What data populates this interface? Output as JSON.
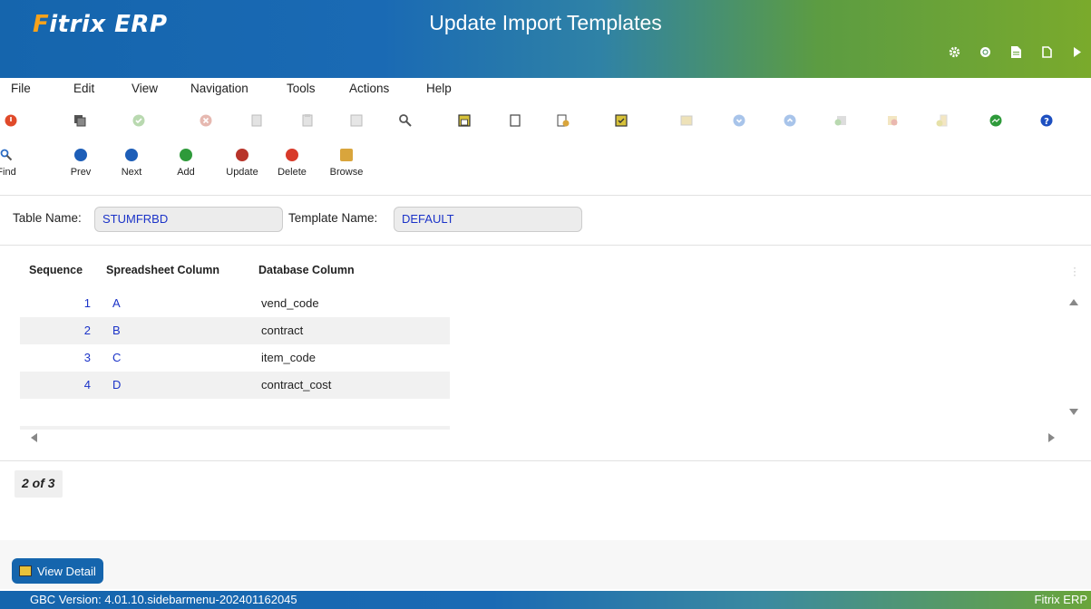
{
  "header": {
    "logo_text": "Fitrix ERP",
    "title": "Update Import Templates",
    "icons": [
      "gear-icon",
      "globe-icon",
      "document-icon",
      "new-page-icon",
      "play-icon"
    ]
  },
  "menu": [
    "File",
    "Edit",
    "View",
    "Navigation",
    "Tools",
    "Actions",
    "Help"
  ],
  "toolbar_icons": [
    "exit-icon",
    "copy-icon",
    "accept-icon",
    "cancel-icon",
    "copy-doc-icon",
    "paste-icon",
    "clipboard-icon",
    "zoom-icon",
    "save-icon",
    "attach-icon",
    "import-icon",
    "export-icon",
    "grid-icon",
    "down-icon",
    "up-icon",
    "insert-row-icon",
    "delete-row-icon",
    "append-icon",
    "chart-icon",
    "help-icon"
  ],
  "actions": [
    {
      "label": "Find",
      "icon": "find-icon",
      "color": "#2a6bc4"
    },
    {
      "label": "Prev",
      "icon": "prev-icon",
      "color": "#1d5eb8"
    },
    {
      "label": "Next",
      "icon": "next-icon",
      "color": "#1d5eb8"
    },
    {
      "label": "Add",
      "icon": "add-icon",
      "color": "#2e9a3a"
    },
    {
      "label": "Update",
      "icon": "update-icon",
      "color": "#c23a2a"
    },
    {
      "label": "Delete",
      "icon": "delete-icon",
      "color": "#d83a2a"
    },
    {
      "label": "Browse",
      "icon": "browse-icon",
      "color": "#d9a53c"
    }
  ],
  "form": {
    "table_name_label": "Table Name:",
    "table_name_value": "STUMFRBD",
    "template_name_label": "Template Name:",
    "template_name_value": "DEFAULT"
  },
  "grid": {
    "columns": [
      "Sequence",
      "Spreadsheet Column",
      "Database Column"
    ],
    "rows": [
      {
        "seq": "1",
        "ss": "A",
        "db": "vend_code"
      },
      {
        "seq": "2",
        "ss": "B",
        "db": "contract"
      },
      {
        "seq": "3",
        "ss": "C",
        "db": "item_code"
      },
      {
        "seq": "4",
        "ss": "D",
        "db": "contract_cost"
      }
    ]
  },
  "pager": "2 of 3",
  "detail_button": "View Detail",
  "status": {
    "version": "GBC Version: 4.01.10.sidebarmenu-202401162045",
    "brand": "Fitrix ERP"
  },
  "colors": {
    "header_blue": "#1565ad",
    "header_green": "#7aaa2c",
    "value_blue": "#1b33c8"
  }
}
